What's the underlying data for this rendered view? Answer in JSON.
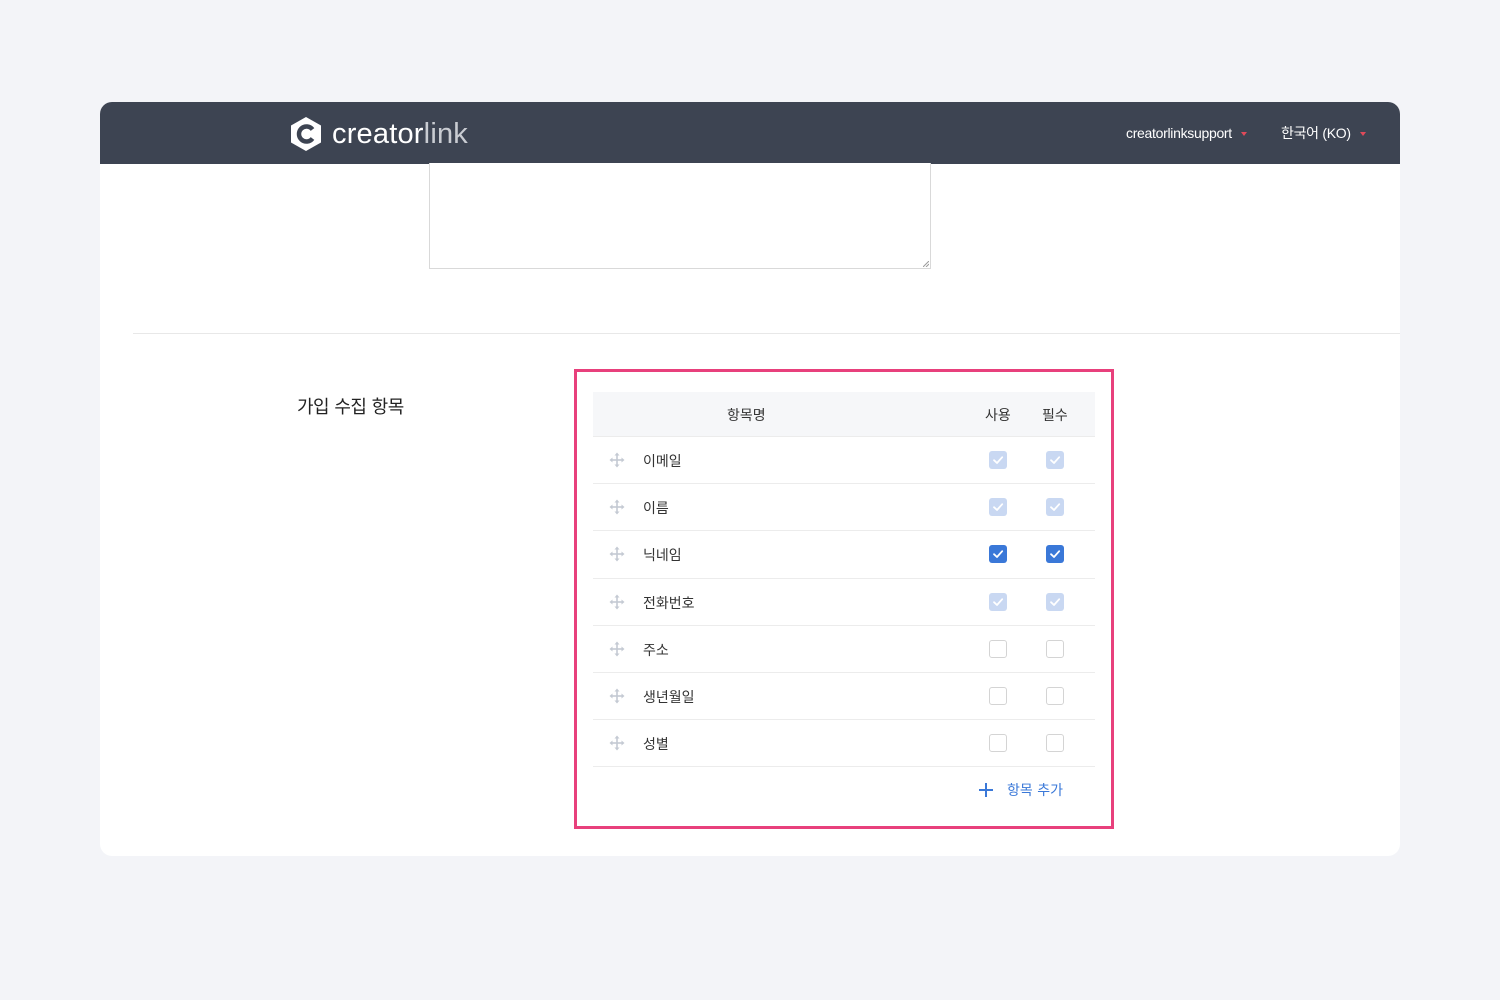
{
  "header": {
    "logo_bold": "creator",
    "logo_light": "link",
    "user_menu": "creatorlinksupport",
    "language_menu": "한국어 (KO)",
    "accent_color": "#e04a5a"
  },
  "section": {
    "title": "가입 수집 항목"
  },
  "fields_table": {
    "columns": {
      "name": "항목명",
      "use": "사용",
      "required": "필수"
    },
    "rows": [
      {
        "label": "이메일",
        "use": "checked-disabled",
        "required": "checked-disabled"
      },
      {
        "label": "이름",
        "use": "checked-disabled",
        "required": "checked-disabled"
      },
      {
        "label": "닉네임",
        "use": "checked",
        "required": "checked"
      },
      {
        "label": "전화번호",
        "use": "checked-disabled",
        "required": "checked-disabled"
      },
      {
        "label": "주소",
        "use": "unchecked",
        "required": "unchecked"
      },
      {
        "label": "생년월일",
        "use": "unchecked",
        "required": "unchecked"
      },
      {
        "label": "성별",
        "use": "unchecked",
        "required": "unchecked"
      }
    ],
    "add_label": "항목 추가",
    "highlight_color": "#e8407c",
    "checkbox_color": "#3a78d8"
  }
}
